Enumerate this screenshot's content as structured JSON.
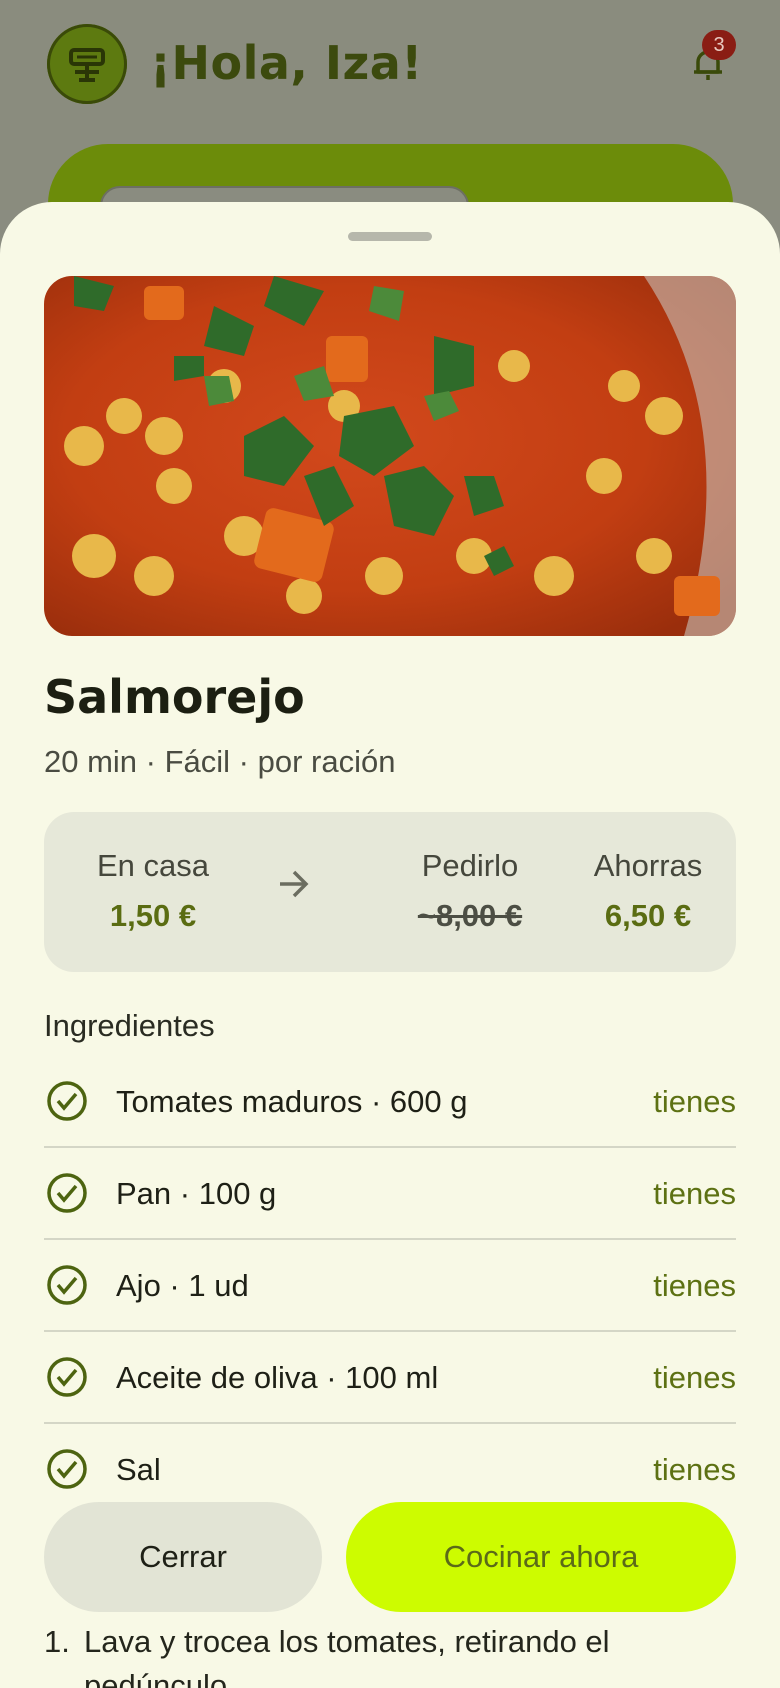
{
  "header": {
    "greeting": "¡Hola, Iza!",
    "logo_icon": "storefront-icon",
    "notifications_count": "3"
  },
  "recipe": {
    "title": "Salmorejo",
    "meta": "20 min · Fácil · por ración"
  },
  "price": {
    "home_label": "En casa",
    "home_value": "1,50 €",
    "order_label": "Pedirlo",
    "order_value": "~8,00 €",
    "save_label": "Ahorras",
    "save_value": "6,50 €"
  },
  "ingredients": {
    "title": "Ingredientes",
    "items": [
      {
        "name": "Tomates maduros · 600 g",
        "status": "tienes"
      },
      {
        "name": "Pan · 100 g",
        "status": "tienes"
      },
      {
        "name": "Ajo · 1 ud",
        "status": "tienes"
      },
      {
        "name": "Aceite de oliva · 100 ml",
        "status": "tienes"
      },
      {
        "name": "Sal",
        "status": "tienes"
      }
    ]
  },
  "actions": {
    "close_label": "Cerrar",
    "cook_label": "Cocinar ahora"
  },
  "steps": {
    "first_number": "1.",
    "first_text_line1": "Lava y trocea los tomates, retirando el",
    "first_text_line2": "pedúnculo."
  },
  "colors": {
    "accent": "#cdfc00",
    "brand_green": "#6c8c0a",
    "sheet_bg": "#f8f9e6"
  }
}
